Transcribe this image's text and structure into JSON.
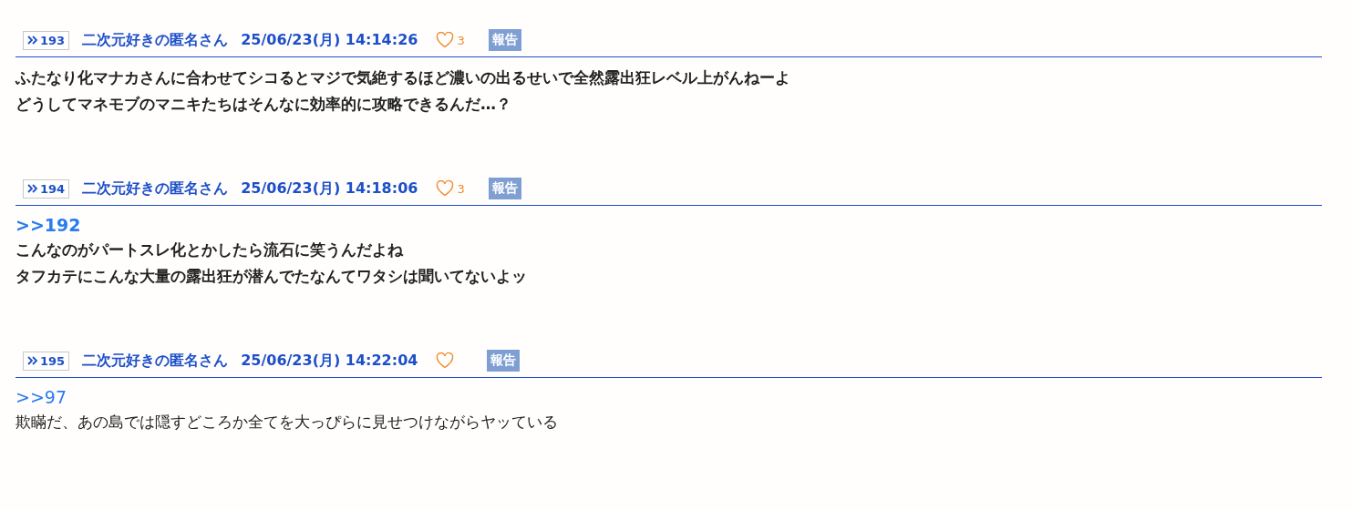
{
  "posts": [
    {
      "number": "193",
      "name": "二次元好きの匿名さん",
      "date": "25/06/23(月) 14:14:26",
      "likes": "3",
      "report": "報告",
      "bold": true,
      "lines": [
        "ふたなり化マナカさんに合わせてシコるとマジで気絶するほど濃いの出るせいで全然露出狂レベル上がんねーよ",
        "どうしてマネモブのマニキたちはそんなに効率的に攻略できるんだ…？"
      ]
    },
    {
      "number": "194",
      "name": "二次元好きの匿名さん",
      "date": "25/06/23(月) 14:18:06",
      "likes": "3",
      "report": "報告",
      "bold": true,
      "reply": ">>192",
      "lines": [
        "こんなのがパートスレ化とかしたら流石に笑うんだよね",
        "タフカテにこんな大量の露出狂が潜んでたなんてワタシは聞いてないよッ"
      ]
    },
    {
      "number": "195",
      "name": "二次元好きの匿名さん",
      "date": "25/06/23(月) 14:22:04",
      "report": "報告",
      "bold": false,
      "reply": ">>97",
      "lines": [
        "欺瞞だ、あの島では隠すどころか全てを大っぴらに見せつけながらヤッている"
      ]
    }
  ]
}
